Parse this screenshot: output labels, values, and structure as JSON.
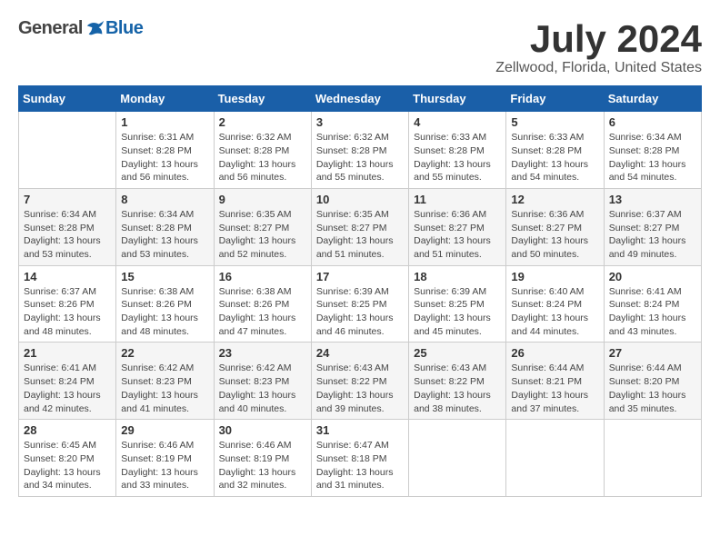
{
  "header": {
    "logo_general": "General",
    "logo_blue": "Blue",
    "title": "July 2024",
    "subtitle": "Zellwood, Florida, United States"
  },
  "weekdays": [
    "Sunday",
    "Monday",
    "Tuesday",
    "Wednesday",
    "Thursday",
    "Friday",
    "Saturday"
  ],
  "weeks": [
    [
      {
        "day": "",
        "info": ""
      },
      {
        "day": "1",
        "info": "Sunrise: 6:31 AM\nSunset: 8:28 PM\nDaylight: 13 hours\nand 56 minutes."
      },
      {
        "day": "2",
        "info": "Sunrise: 6:32 AM\nSunset: 8:28 PM\nDaylight: 13 hours\nand 56 minutes."
      },
      {
        "day": "3",
        "info": "Sunrise: 6:32 AM\nSunset: 8:28 PM\nDaylight: 13 hours\nand 55 minutes."
      },
      {
        "day": "4",
        "info": "Sunrise: 6:33 AM\nSunset: 8:28 PM\nDaylight: 13 hours\nand 55 minutes."
      },
      {
        "day": "5",
        "info": "Sunrise: 6:33 AM\nSunset: 8:28 PM\nDaylight: 13 hours\nand 54 minutes."
      },
      {
        "day": "6",
        "info": "Sunrise: 6:34 AM\nSunset: 8:28 PM\nDaylight: 13 hours\nand 54 minutes."
      }
    ],
    [
      {
        "day": "7",
        "info": "Sunrise: 6:34 AM\nSunset: 8:28 PM\nDaylight: 13 hours\nand 53 minutes."
      },
      {
        "day": "8",
        "info": "Sunrise: 6:34 AM\nSunset: 8:28 PM\nDaylight: 13 hours\nand 53 minutes."
      },
      {
        "day": "9",
        "info": "Sunrise: 6:35 AM\nSunset: 8:27 PM\nDaylight: 13 hours\nand 52 minutes."
      },
      {
        "day": "10",
        "info": "Sunrise: 6:35 AM\nSunset: 8:27 PM\nDaylight: 13 hours\nand 51 minutes."
      },
      {
        "day": "11",
        "info": "Sunrise: 6:36 AM\nSunset: 8:27 PM\nDaylight: 13 hours\nand 51 minutes."
      },
      {
        "day": "12",
        "info": "Sunrise: 6:36 AM\nSunset: 8:27 PM\nDaylight: 13 hours\nand 50 minutes."
      },
      {
        "day": "13",
        "info": "Sunrise: 6:37 AM\nSunset: 8:27 PM\nDaylight: 13 hours\nand 49 minutes."
      }
    ],
    [
      {
        "day": "14",
        "info": "Sunrise: 6:37 AM\nSunset: 8:26 PM\nDaylight: 13 hours\nand 48 minutes."
      },
      {
        "day": "15",
        "info": "Sunrise: 6:38 AM\nSunset: 8:26 PM\nDaylight: 13 hours\nand 48 minutes."
      },
      {
        "day": "16",
        "info": "Sunrise: 6:38 AM\nSunset: 8:26 PM\nDaylight: 13 hours\nand 47 minutes."
      },
      {
        "day": "17",
        "info": "Sunrise: 6:39 AM\nSunset: 8:25 PM\nDaylight: 13 hours\nand 46 minutes."
      },
      {
        "day": "18",
        "info": "Sunrise: 6:39 AM\nSunset: 8:25 PM\nDaylight: 13 hours\nand 45 minutes."
      },
      {
        "day": "19",
        "info": "Sunrise: 6:40 AM\nSunset: 8:24 PM\nDaylight: 13 hours\nand 44 minutes."
      },
      {
        "day": "20",
        "info": "Sunrise: 6:41 AM\nSunset: 8:24 PM\nDaylight: 13 hours\nand 43 minutes."
      }
    ],
    [
      {
        "day": "21",
        "info": "Sunrise: 6:41 AM\nSunset: 8:24 PM\nDaylight: 13 hours\nand 42 minutes."
      },
      {
        "day": "22",
        "info": "Sunrise: 6:42 AM\nSunset: 8:23 PM\nDaylight: 13 hours\nand 41 minutes."
      },
      {
        "day": "23",
        "info": "Sunrise: 6:42 AM\nSunset: 8:23 PM\nDaylight: 13 hours\nand 40 minutes."
      },
      {
        "day": "24",
        "info": "Sunrise: 6:43 AM\nSunset: 8:22 PM\nDaylight: 13 hours\nand 39 minutes."
      },
      {
        "day": "25",
        "info": "Sunrise: 6:43 AM\nSunset: 8:22 PM\nDaylight: 13 hours\nand 38 minutes."
      },
      {
        "day": "26",
        "info": "Sunrise: 6:44 AM\nSunset: 8:21 PM\nDaylight: 13 hours\nand 37 minutes."
      },
      {
        "day": "27",
        "info": "Sunrise: 6:44 AM\nSunset: 8:20 PM\nDaylight: 13 hours\nand 35 minutes."
      }
    ],
    [
      {
        "day": "28",
        "info": "Sunrise: 6:45 AM\nSunset: 8:20 PM\nDaylight: 13 hours\nand 34 minutes."
      },
      {
        "day": "29",
        "info": "Sunrise: 6:46 AM\nSunset: 8:19 PM\nDaylight: 13 hours\nand 33 minutes."
      },
      {
        "day": "30",
        "info": "Sunrise: 6:46 AM\nSunset: 8:19 PM\nDaylight: 13 hours\nand 32 minutes."
      },
      {
        "day": "31",
        "info": "Sunrise: 6:47 AM\nSunset: 8:18 PM\nDaylight: 13 hours\nand 31 minutes."
      },
      {
        "day": "",
        "info": ""
      },
      {
        "day": "",
        "info": ""
      },
      {
        "day": "",
        "info": ""
      }
    ]
  ]
}
